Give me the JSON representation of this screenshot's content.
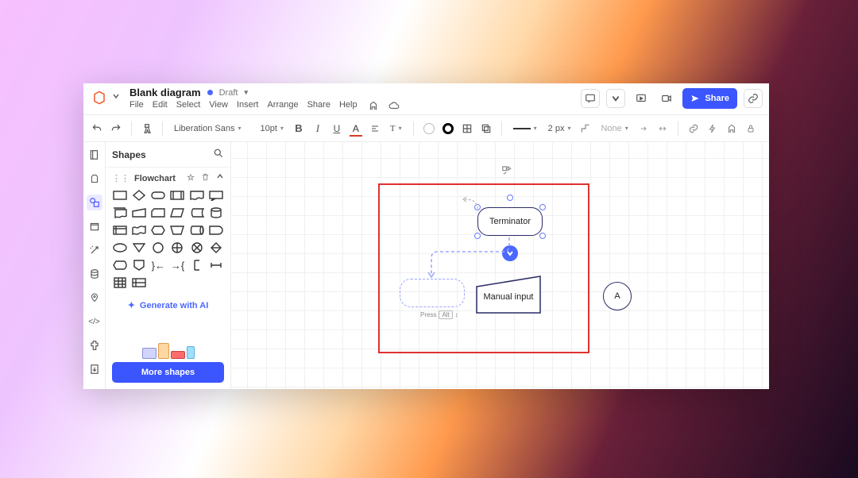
{
  "doc": {
    "title": "Blank diagram",
    "status": "Draft"
  },
  "menus": {
    "file": "File",
    "edit": "Edit",
    "select": "Select",
    "view": "View",
    "insert": "Insert",
    "arrange": "Arrange",
    "share": "Share",
    "help": "Help"
  },
  "top_right": {
    "share_label": "Share"
  },
  "toolbar": {
    "font": "Liberation Sans",
    "size": "10pt",
    "stroke_width": "2 px",
    "line_end": "None"
  },
  "panel": {
    "title": "Shapes",
    "section": "Flowchart",
    "generate_ai": "Generate with AI",
    "more_shapes": "More shapes"
  },
  "canvas": {
    "terminator_label": "Terminator",
    "manual_input_label": "Manual input",
    "circle_label": "A",
    "hint_press": "Press",
    "hint_key": "Alt"
  }
}
